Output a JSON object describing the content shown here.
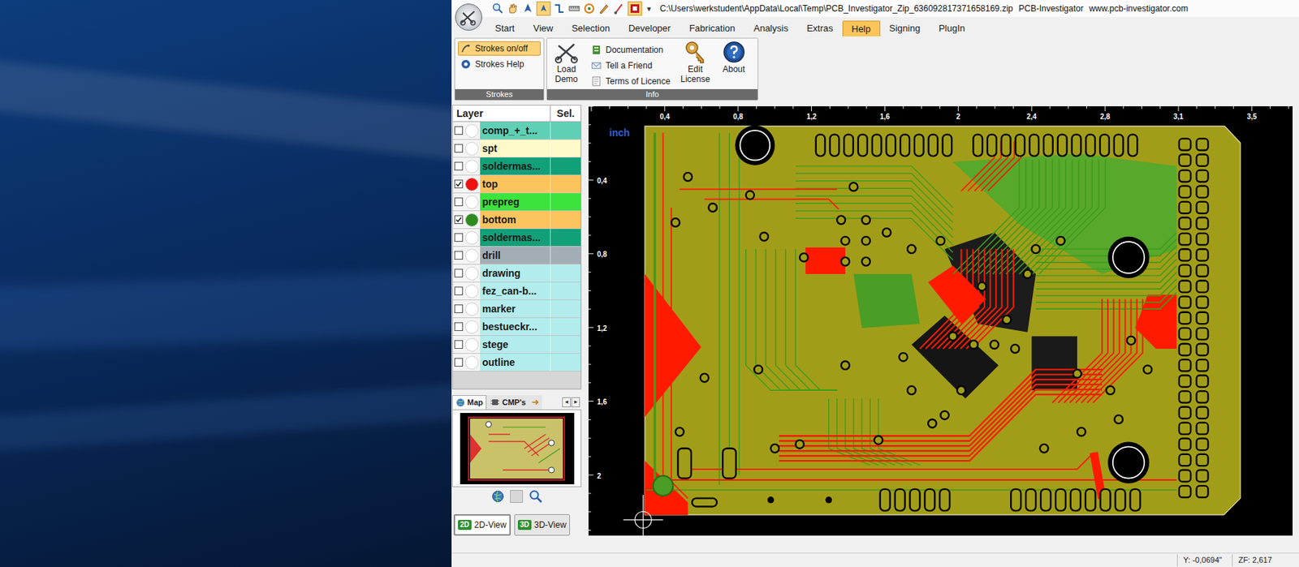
{
  "window": {
    "title": "C:\\Users\\werkstudent\\AppData\\Local\\Temp\\PCB_Investigator_Zip_636092817371658169.zip",
    "app": "PCB-Investigator",
    "website": "www.pcb-investigator.com"
  },
  "quick_access": {
    "more": "▾"
  },
  "tabs": [
    {
      "label": "Start",
      "selected": false
    },
    {
      "label": "View",
      "selected": false
    },
    {
      "label": "Selection",
      "selected": false
    },
    {
      "label": "Developer",
      "selected": false
    },
    {
      "label": "Fabrication",
      "selected": false
    },
    {
      "label": "Analysis",
      "selected": false
    },
    {
      "label": "Extras",
      "selected": false
    },
    {
      "label": "Help",
      "selected": true
    },
    {
      "label": "Signing",
      "selected": false
    },
    {
      "label": "PlugIn",
      "selected": false
    }
  ],
  "ribbon": {
    "groups": [
      {
        "label": "Strokes",
        "items": [
          {
            "label": "Strokes on/off",
            "kind": "small",
            "selected": true
          },
          {
            "label": "Strokes Help",
            "kind": "small",
            "selected": false
          }
        ]
      },
      {
        "label": "Info",
        "items": [
          {
            "label": "Load Demo",
            "kind": "large",
            "selected": false
          },
          {
            "label": "Documentation",
            "kind": "small",
            "selected": false
          },
          {
            "label": "Tell a Friend",
            "kind": "small",
            "selected": false
          },
          {
            "label": "Terms of Licence",
            "kind": "small",
            "selected": false
          },
          {
            "label": "Edit License",
            "kind": "large",
            "selected": false
          },
          {
            "label": "About",
            "kind": "large",
            "selected": false
          }
        ]
      }
    ]
  },
  "layers": {
    "columns": [
      "Layer",
      "Sel."
    ],
    "rows": [
      {
        "name": "comp_+_t...",
        "checked": false,
        "dot_color": "#ffffff",
        "color": "#5fd0b6"
      },
      {
        "name": "spt",
        "checked": false,
        "dot_color": "#ffffff",
        "color": "#fdf9c9"
      },
      {
        "name": "soldermas...",
        "checked": false,
        "dot_color": "#ffffff",
        "color": "#12a078"
      },
      {
        "name": "top",
        "checked": true,
        "dot_color": "#f01010",
        "color": "#fbc35c"
      },
      {
        "name": "prepreg",
        "checked": false,
        "dot_color": "#ffffff",
        "color": "#3ce33c"
      },
      {
        "name": "bottom",
        "checked": true,
        "dot_color": "#2e8b1e",
        "color": "#fbc35c"
      },
      {
        "name": "soldermas...",
        "checked": false,
        "dot_color": "#ffffff",
        "color": "#12a078"
      },
      {
        "name": "drill",
        "checked": false,
        "dot_color": "#ffffff",
        "color": "#a3adb6"
      },
      {
        "name": "drawing",
        "checked": false,
        "dot_color": "#ffffff",
        "color": "#b3ecec"
      },
      {
        "name": "fez_can-b...",
        "checked": false,
        "dot_color": "#ffffff",
        "color": "#b3ecec"
      },
      {
        "name": "marker",
        "checked": false,
        "dot_color": "#ffffff",
        "color": "#b3ecec"
      },
      {
        "name": "bestueckr...",
        "checked": false,
        "dot_color": "#ffffff",
        "color": "#b3ecec"
      },
      {
        "name": "stege",
        "checked": false,
        "dot_color": "#ffffff",
        "color": "#b3ecec"
      },
      {
        "name": "outline",
        "checked": false,
        "dot_color": "#ffffff",
        "color": "#b3ecec"
      }
    ]
  },
  "side_tabs": [
    {
      "label": "Map",
      "selected": true
    },
    {
      "label": "CMP's",
      "selected": false
    }
  ],
  "side_nav": [
    "◂",
    "▸"
  ],
  "view_buttons": [
    {
      "badge": "2D",
      "label": "2D-View",
      "selected": true
    },
    {
      "badge": "3D",
      "label": "3D-View",
      "selected": false
    }
  ],
  "canvas": {
    "unit": "inch",
    "x_ticks": [
      "0,4",
      "0,8",
      "1,2",
      "1,6",
      "2",
      "2,4",
      "2,8",
      "3,1",
      "3,5"
    ],
    "y_ticks": [
      "0,4",
      "0,8",
      "1,2",
      "1,6",
      "2"
    ]
  },
  "status_bar": {
    "y": "Y: -0,0694\"",
    "zoom": "ZF: 2,617"
  }
}
